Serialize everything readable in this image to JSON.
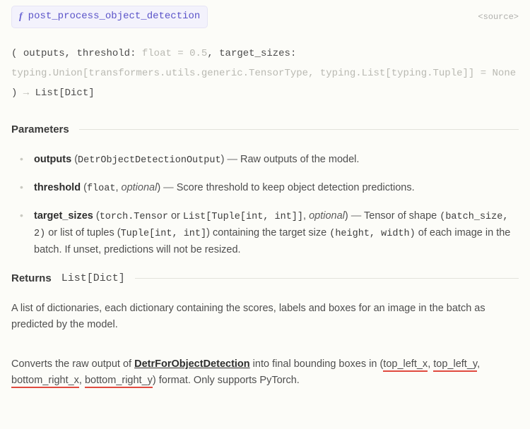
{
  "header": {
    "fn_prefix": "f",
    "fn_name": "post_process_object_detection",
    "source_label": "source"
  },
  "signature": {
    "open": "( ",
    "arg1": "outputs",
    "sep1": ", ",
    "arg2": "threshold",
    "colon2": ": ",
    "type2": "float",
    "eq2": " = ",
    "def2": "0.5",
    "sep2": ", ",
    "arg3": "target_sizes",
    "colon3": ": ",
    "type3": "typing.Union[transformers.utils.generic.TensorType, typing.List[typing.Tuple]]",
    "eq3": " = ",
    "def3": "None",
    "close": " )",
    "arrow": " → ",
    "ret": "List[Dict]"
  },
  "sections": {
    "parameters": "Parameters",
    "returns": "Returns",
    "returns_type": "List[Dict]"
  },
  "params": {
    "outputs": {
      "name": "outputs",
      "type": "DetrObjectDetectionOutput",
      "desc": "Raw outputs of the model."
    },
    "threshold": {
      "name": "threshold",
      "type": "float",
      "optional": "optional",
      "desc": "Score threshold to keep object detection predictions."
    },
    "target_sizes": {
      "name": "target_sizes",
      "type1": "torch.Tensor",
      "or": " or ",
      "type2": "List[Tuple[int, int]]",
      "optional": "optional",
      "desc_a": "Tensor of shape ",
      "shape": "(batch_size, 2)",
      "desc_b": " or list of tuples (",
      "tuple": "Tuple[int, int]",
      "desc_c": ") containing the target size ",
      "hw": "(height, width)",
      "desc_d": " of each image in the batch. If unset, predictions will not be resized."
    }
  },
  "returns_desc": "A list of dictionaries, each dictionary containing the scores, labels and boxes for an image in the batch as predicted by the model.",
  "footer": {
    "a": "Converts the raw output of ",
    "link": "DetrForObjectDetection",
    "b": " into final bounding boxes in (",
    "c1": "top_left_x",
    "s1": ", ",
    "c2": "top_left_y",
    "s2": ", ",
    "c3": "bottom_right_x",
    "s3": ", ",
    "c4": "bottom_right_y",
    "d": ") format. Only supports PyTorch."
  }
}
